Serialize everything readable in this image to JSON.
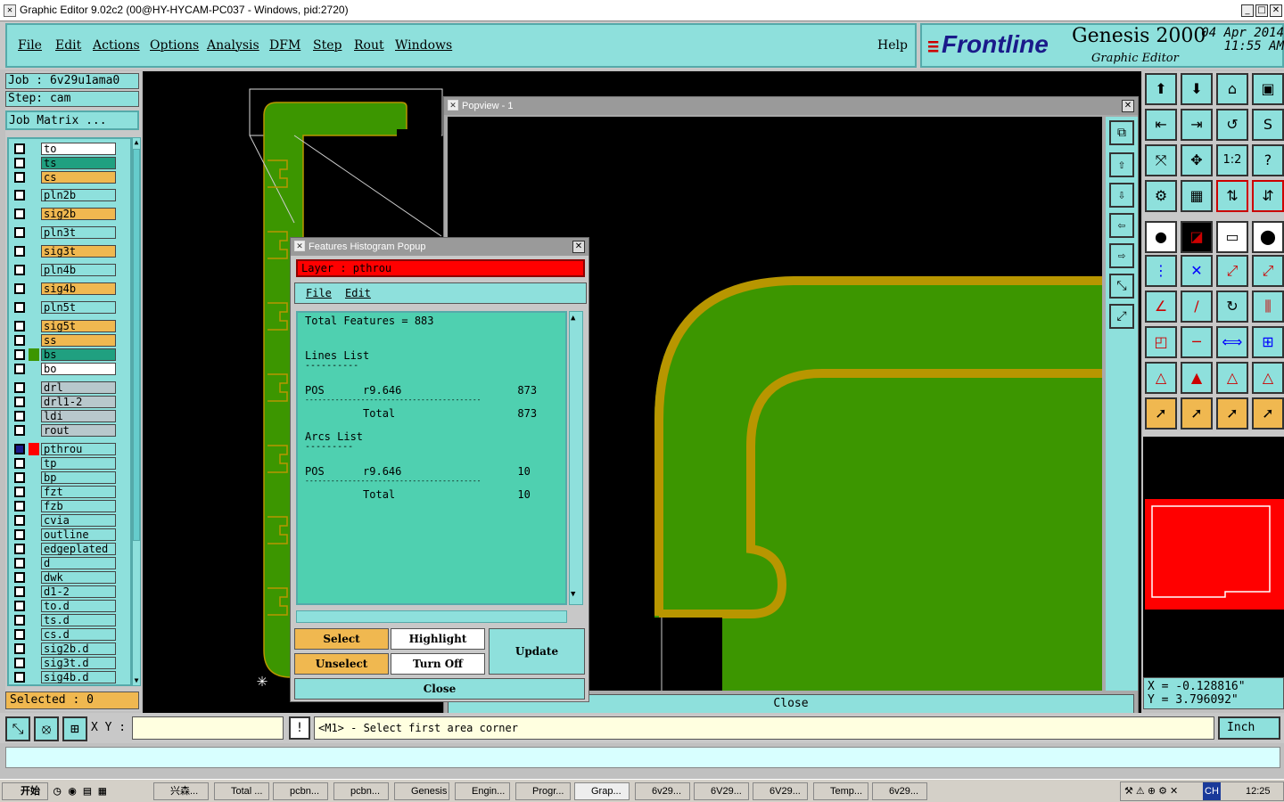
{
  "window": {
    "title": "Graphic Editor 9.02c2 (00@HY-HYCAM-PC037 - Windows, pid:2720)"
  },
  "menu": {
    "items": [
      "File",
      "Edit",
      "Actions",
      "Options",
      "Analysis",
      "DFM",
      "Step",
      "Rout",
      "Windows"
    ],
    "help": "Help"
  },
  "brand": {
    "logo": "Frontline",
    "product": "Genesis 2000",
    "subtitle": "Graphic Editor",
    "date": "04 Apr 2014",
    "time": "11:55 AM"
  },
  "job": {
    "job_label": "Job  :  6v29u1ama0",
    "step_label": "Step:  cam",
    "matrix_button": "Job Matrix ..."
  },
  "layers": [
    {
      "name": "to",
      "color": "#ffffff"
    },
    {
      "name": "ts",
      "color": "#20a080"
    },
    {
      "name": "cs",
      "color": "#f0b850"
    },
    {
      "name": "pln2b",
      "color": "#8ee0dc"
    },
    {
      "name": "sig2b",
      "color": "#f0b850"
    },
    {
      "name": "pln3t",
      "color": "#8ee0dc"
    },
    {
      "name": "sig3t",
      "color": "#f0b850"
    },
    {
      "name": "pln4b",
      "color": "#8ee0dc"
    },
    {
      "name": "sig4b",
      "color": "#f0b850"
    },
    {
      "name": "pln5t",
      "color": "#8ee0dc"
    },
    {
      "name": "sig5t",
      "color": "#f0b850"
    },
    {
      "name": "ss",
      "color": "#f0b850"
    },
    {
      "name": "bs",
      "color": "#20a080"
    },
    {
      "name": "bo",
      "color": "#ffffff"
    },
    {
      "name": "drl",
      "color": "#b8c8cc"
    },
    {
      "name": "drl1-2",
      "color": "#b8c8cc"
    },
    {
      "name": "ldi",
      "color": "#b8c8cc"
    },
    {
      "name": "rout",
      "color": "#b8c8cc"
    },
    {
      "name": "pthrou",
      "color": "#8ee0dc"
    },
    {
      "name": "tp",
      "color": "#8ee0dc"
    },
    {
      "name": "bp",
      "color": "#8ee0dc"
    },
    {
      "name": "fzt",
      "color": "#8ee0dc"
    },
    {
      "name": "fzb",
      "color": "#8ee0dc"
    },
    {
      "name": "cvia",
      "color": "#8ee0dc"
    },
    {
      "name": "outline",
      "color": "#8ee0dc"
    },
    {
      "name": "edgeplated",
      "color": "#8ee0dc"
    },
    {
      "name": "d",
      "color": "#8ee0dc"
    },
    {
      "name": "dwk",
      "color": "#8ee0dc"
    },
    {
      "name": "d1-2",
      "color": "#8ee0dc"
    },
    {
      "name": "to.d",
      "color": "#8ee0dc"
    },
    {
      "name": "ts.d",
      "color": "#8ee0dc"
    },
    {
      "name": "cs.d",
      "color": "#8ee0dc"
    },
    {
      "name": "sig2b.d",
      "color": "#8ee0dc"
    },
    {
      "name": "sig3t.d",
      "color": "#8ee0dc"
    },
    {
      "name": "sig4b.d",
      "color": "#8ee0dc"
    }
  ],
  "selected": "Selected : 0",
  "popview": {
    "title": "Popview - 1",
    "close": "Close"
  },
  "histogram": {
    "title": "Features Histogram Popup",
    "layer": "Layer  :  pthrou",
    "menu": [
      "File",
      "Edit"
    ],
    "lines": [
      "Total Features = 883",
      "",
      "",
      "Lines List",
      "----------",
      "",
      "POS      r9.646                  873",
      "-----------------------------------------",
      "         Total                   873",
      "",
      "Arcs List",
      "---------",
      "",
      "POS      r9.646                  10",
      "-----------------------------------------",
      "         Total                   10"
    ],
    "buttons": {
      "select": "Select",
      "highlight": "Highlight",
      "update": "Update",
      "unselect": "Unselect",
      "turnoff": "Turn Off",
      "close": "Close"
    }
  },
  "coords": {
    "x": "X = -0.128816\"",
    "y": "Y = 3.796092\""
  },
  "status": {
    "xy_label": "X Y :",
    "xy_value": "",
    "prompt": "<M1> - Select first area corner",
    "unit": "Inch"
  },
  "taskbar": {
    "start": "开始",
    "items": [
      "兴森...",
      "Total ...",
      "pcbn...",
      "pcbn...",
      "Genesis",
      "Engin...",
      "Progr...",
      "Grap...",
      "6v29...",
      "6V29...",
      "6V29...",
      "Temp...",
      "6v29..."
    ],
    "tray_lang": "CH",
    "clock": "12:25"
  },
  "colors": {
    "teal": "#8ee0dc",
    "board": "#3c9600",
    "trace": "#b89600",
    "red": "#ff0000"
  }
}
